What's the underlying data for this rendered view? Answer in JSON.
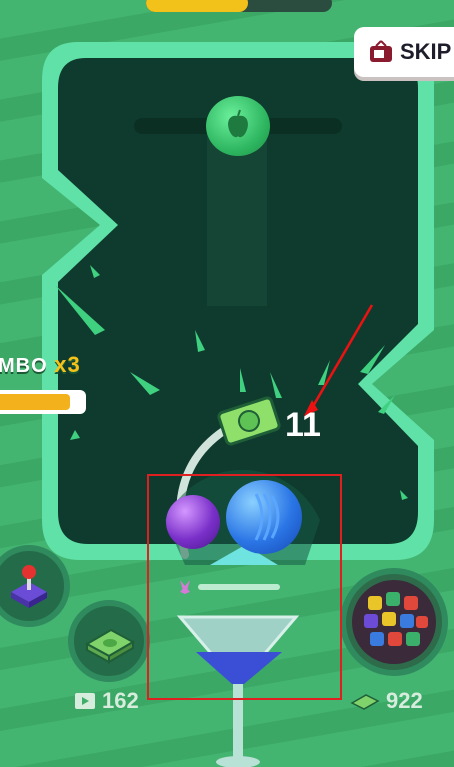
{
  "top_progress": {
    "fill_fraction": 0.55,
    "color": "#f2c11a"
  },
  "skip": {
    "label": "SKIP",
    "icon": "tv-icon"
  },
  "combo": {
    "label": "MBO",
    "multiplier": "x3",
    "fill_fraction": 0.88
  },
  "score_popup": {
    "value": "11",
    "icon": "cash-icon"
  },
  "left_buttons": [
    {
      "icon": "joystick-icon"
    },
    {
      "icon": "cash-stack-icon",
      "count": "162",
      "count_icon": "video-icon"
    }
  ],
  "right_button": {
    "icon": "skin-ball-icon",
    "count": "922",
    "count_icon": "cash-icon"
  },
  "balls": [
    {
      "icon": "apple-icon",
      "color": "#39c36b"
    },
    {
      "color": "#7a30c9"
    },
    {
      "color": "#2b76e6"
    }
  ],
  "glass": {
    "liquid_color": "#3a4fd6"
  },
  "colors": {
    "board_border": "#5fe1a7",
    "board_fill": "#0f3b2e",
    "background": "#3fae6b",
    "highlight_box": "#e02020"
  }
}
